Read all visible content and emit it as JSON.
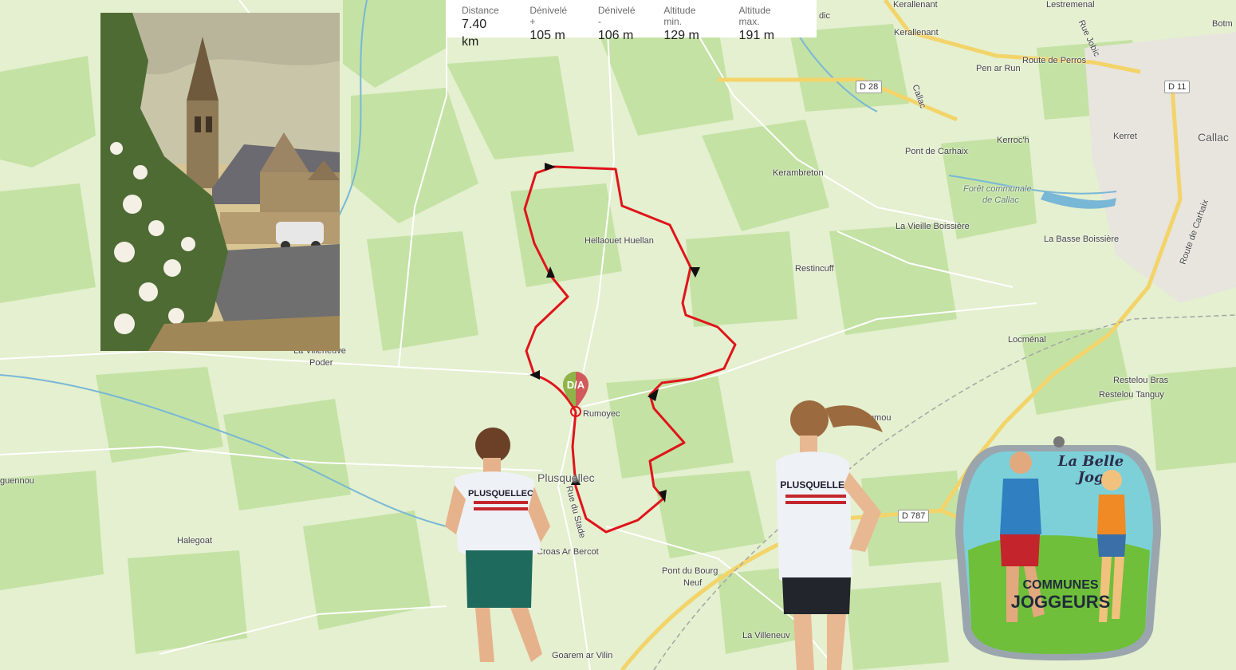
{
  "stats": [
    {
      "label": "Distance",
      "value": "7.40 km"
    },
    {
      "label": "Dénivelé +",
      "value": "105 m"
    },
    {
      "label": "Dénivelé -",
      "value": "106 m"
    },
    {
      "label": "Altitude min.",
      "value": "129 m"
    },
    {
      "label": "Altitude max.",
      "value": "191 m"
    }
  ],
  "marker_label": "D/A",
  "places": {
    "kerallenant": "Kerallenant",
    "lestremenal": "Lestremenal",
    "botm": "Botm",
    "route_perros": "Route de Perros",
    "rue_jobic": "Rue Jobic",
    "pen_ar_run": "Pen ar Run",
    "d28": "D 28",
    "d11": "D 11",
    "callac_road": "Callac",
    "kerret": "Kerret",
    "callac": "Callac",
    "kerroch": "Kerroc'h",
    "pont_carhaix": "Pont de Carhaix",
    "kerambreton": "Kerambreton",
    "foret1": "Forêt communale",
    "foret2": "de Callac",
    "vieille_boissiere": "La Vieille Boissière",
    "basse_boissiere": "La Basse Boissière",
    "route_carhaix": "Route de Carhaix",
    "hellaouet": "Hellaouet Huellan",
    "restincuff": "Restincuff",
    "locmenal": "Locménal",
    "restelou_bras": "Restelou Bras",
    "restelou_tanguy": "Restelou Tanguy",
    "villeneuve_poder1": "La Villeneuve",
    "villeneuve_poder2": "Poder",
    "rumoyec": "Rumoyec",
    "plusquellec": "Plusquellec",
    "rue_stade": "Rue du Stade",
    "croas": "Croas Ar Bercot",
    "pont_bourg1": "Pont du Bourg",
    "pont_bourg2": "Neuf",
    "d787": "D 787",
    "halegoat": "Halegoat",
    "guennou": "guennou",
    "villeneuve": "La Villeneuv",
    "goarem": "Goarem ar Vilin",
    "dic": "dic",
    "rumou": "Rumou"
  },
  "runner_shirt": "PLUSQUELLEC",
  "badge": {
    "brand_line1": "La Belle",
    "brand_line2": "Jog",
    "line1": "COMMUNES",
    "line2": "JOGGEURS"
  },
  "colors": {
    "route": "#e0141b",
    "map_light": "#dfeec8",
    "map_dark": "#bddf9d",
    "water": "#79b7d6",
    "main_road": "#f3d46a"
  }
}
